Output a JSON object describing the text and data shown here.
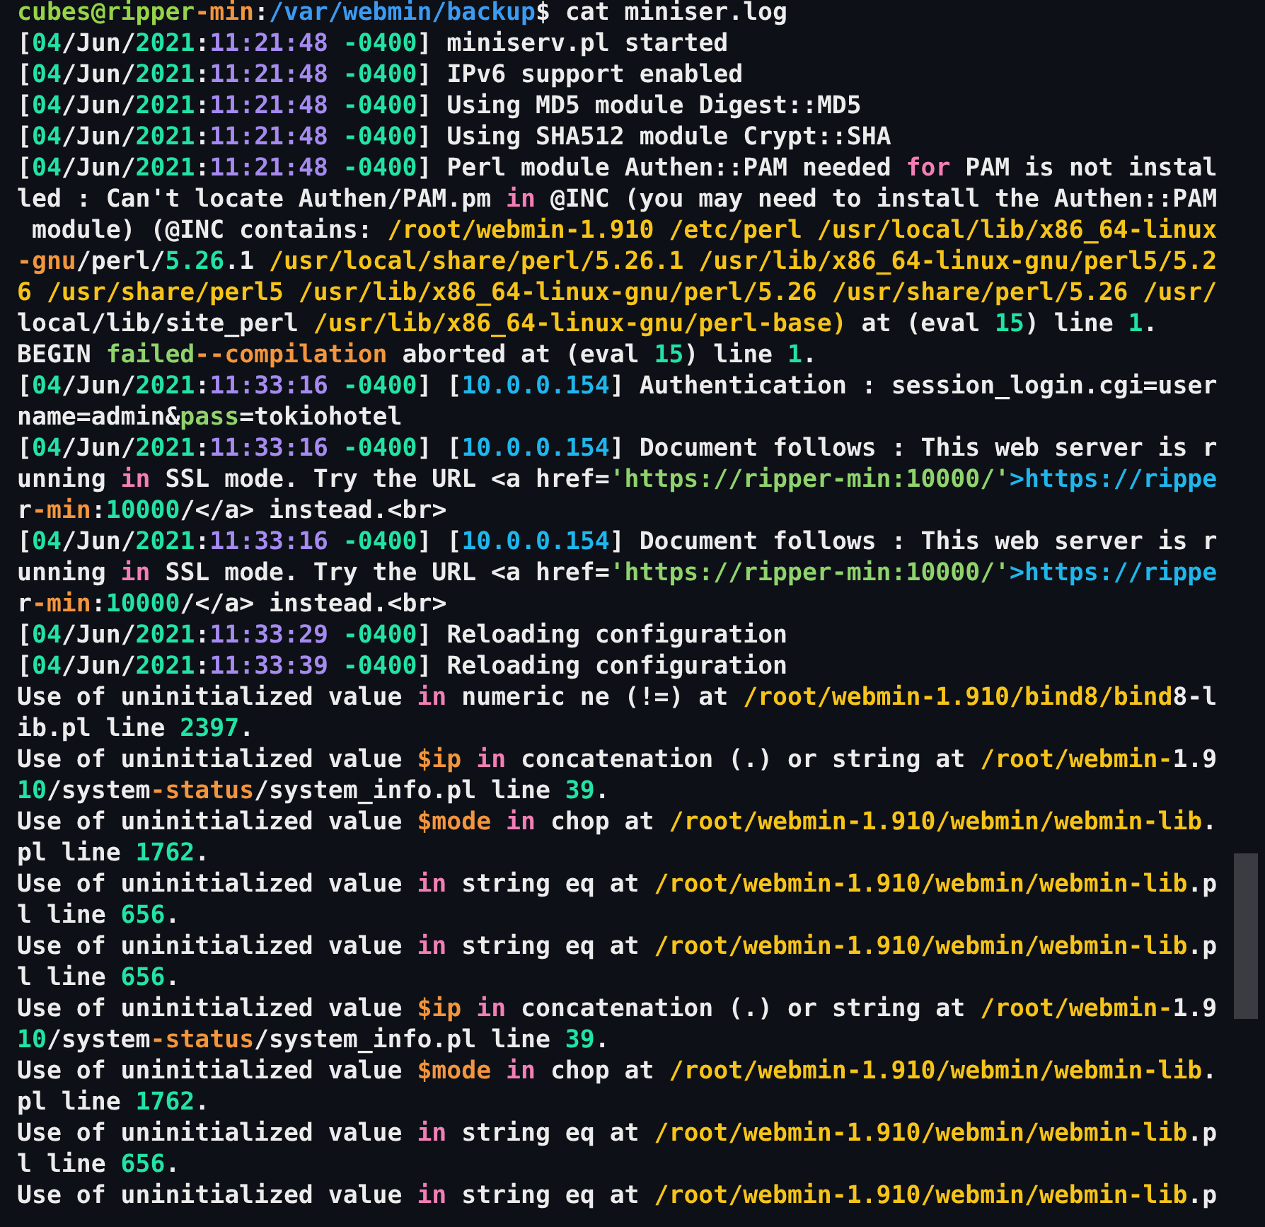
{
  "terminal": {
    "lines": [
      {
        "segments": [
          {
            "kind": "user",
            "text": "cubes@ripper"
          },
          {
            "kind": "var",
            "text": "-min"
          },
          {
            "kind": "plain",
            "text": ":"
          },
          {
            "kind": "dir",
            "text": "/var/webmin/backup"
          },
          {
            "kind": "plain",
            "text": "$ cat miniser.log"
          }
        ]
      },
      {
        "segments": [
          {
            "kind": "plain",
            "text": "["
          },
          {
            "kind": "num",
            "text": "04"
          },
          {
            "kind": "plain",
            "text": "/Jun/"
          },
          {
            "kind": "num",
            "text": "2021"
          },
          {
            "kind": "plain",
            "text": ":"
          },
          {
            "kind": "time",
            "text": "11:21:48"
          },
          {
            "kind": "num",
            "text": " -0400"
          },
          {
            "kind": "plain",
            "text": "] miniserv.pl started"
          }
        ]
      },
      {
        "segments": [
          {
            "kind": "plain",
            "text": "["
          },
          {
            "kind": "num",
            "text": "04"
          },
          {
            "kind": "plain",
            "text": "/Jun/"
          },
          {
            "kind": "num",
            "text": "2021"
          },
          {
            "kind": "plain",
            "text": ":"
          },
          {
            "kind": "time",
            "text": "11:21:48"
          },
          {
            "kind": "num",
            "text": " -0400"
          },
          {
            "kind": "plain",
            "text": "] IPv6 support enabled"
          }
        ]
      },
      {
        "segments": [
          {
            "kind": "plain",
            "text": "["
          },
          {
            "kind": "num",
            "text": "04"
          },
          {
            "kind": "plain",
            "text": "/Jun/"
          },
          {
            "kind": "num",
            "text": "2021"
          },
          {
            "kind": "plain",
            "text": ":"
          },
          {
            "kind": "time",
            "text": "11:21:48"
          },
          {
            "kind": "num",
            "text": " -0400"
          },
          {
            "kind": "plain",
            "text": "] Using MD5 module Digest::MD5"
          }
        ]
      },
      {
        "segments": [
          {
            "kind": "plain",
            "text": "["
          },
          {
            "kind": "num",
            "text": "04"
          },
          {
            "kind": "plain",
            "text": "/Jun/"
          },
          {
            "kind": "num",
            "text": "2021"
          },
          {
            "kind": "plain",
            "text": ":"
          },
          {
            "kind": "time",
            "text": "11:21:48"
          },
          {
            "kind": "num",
            "text": " -0400"
          },
          {
            "kind": "plain",
            "text": "] Using SHA512 module Crypt::SHA"
          }
        ]
      },
      {
        "segments": [
          {
            "kind": "plain",
            "text": "["
          },
          {
            "kind": "num",
            "text": "04"
          },
          {
            "kind": "plain",
            "text": "/Jun/"
          },
          {
            "kind": "num",
            "text": "2021"
          },
          {
            "kind": "plain",
            "text": ":"
          },
          {
            "kind": "time",
            "text": "11:21:48"
          },
          {
            "kind": "num",
            "text": " -0400"
          },
          {
            "kind": "plain",
            "text": "] Perl module Authen::PAM needed "
          },
          {
            "kind": "kw",
            "text": "for"
          },
          {
            "kind": "plain",
            "text": " PAM is not instal"
          }
        ]
      },
      {
        "segments": [
          {
            "kind": "plain",
            "text": "led : Can't locate Authen/PAM.pm "
          },
          {
            "kind": "kw",
            "text": "in"
          },
          {
            "kind": "plain",
            "text": " @INC (you may need to install the Authen::PAM"
          }
        ]
      },
      {
        "segments": [
          {
            "kind": "plain",
            "text": " module) (@INC contains: "
          },
          {
            "kind": "path",
            "text": "/root/webmin-1.910 /etc/perl /usr/local/lib/x86_64-linux"
          }
        ]
      },
      {
        "segments": [
          {
            "kind": "var",
            "text": "-gnu"
          },
          {
            "kind": "plain",
            "text": "/perl/"
          },
          {
            "kind": "num",
            "text": "5.26"
          },
          {
            "kind": "plain",
            "text": ".1 "
          },
          {
            "kind": "path",
            "text": "/usr/local/share/perl/5.26.1 /usr/lib/x86_64-linux-gnu/perl5/5.2"
          }
        ]
      },
      {
        "segments": [
          {
            "kind": "path",
            "text": "6 /usr/share/perl5 /usr/lib/x86_64-linux-gnu/perl/5.26 /usr/share/perl/5.26 /usr/"
          }
        ]
      },
      {
        "segments": [
          {
            "kind": "plain",
            "text": "local/lib/site_perl "
          },
          {
            "kind": "path",
            "text": "/usr/lib/x86_64-linux-gnu/perl-base)"
          },
          {
            "kind": "plain",
            "text": " at (eval "
          },
          {
            "kind": "num",
            "text": "15"
          },
          {
            "kind": "plain",
            "text": ") line "
          },
          {
            "kind": "num",
            "text": "1"
          },
          {
            "kind": "plain",
            "text": "."
          }
        ]
      },
      {
        "segments": [
          {
            "kind": "plain",
            "text": "BEGIN "
          },
          {
            "kind": "str",
            "text": "failed"
          },
          {
            "kind": "var",
            "text": "--compilation"
          },
          {
            "kind": "plain",
            "text": " aborted at (eval "
          },
          {
            "kind": "num",
            "text": "15"
          },
          {
            "kind": "plain",
            "text": ") line "
          },
          {
            "kind": "num",
            "text": "1"
          },
          {
            "kind": "plain",
            "text": "."
          }
        ]
      },
      {
        "segments": [
          {
            "kind": "plain",
            "text": "["
          },
          {
            "kind": "num",
            "text": "04"
          },
          {
            "kind": "plain",
            "text": "/Jun/"
          },
          {
            "kind": "num",
            "text": "2021"
          },
          {
            "kind": "plain",
            "text": ":"
          },
          {
            "kind": "time",
            "text": "11:33:16"
          },
          {
            "kind": "num",
            "text": " -0400"
          },
          {
            "kind": "plain",
            "text": "] ["
          },
          {
            "kind": "link",
            "text": "10.0.0.154"
          },
          {
            "kind": "plain",
            "text": "] Authentication : session_login.cgi=user"
          }
        ]
      },
      {
        "segments": [
          {
            "kind": "plain",
            "text": "name=admin&"
          },
          {
            "kind": "str",
            "text": "pass"
          },
          {
            "kind": "plain",
            "text": "=tokiohotel"
          }
        ]
      },
      {
        "segments": [
          {
            "kind": "plain",
            "text": "["
          },
          {
            "kind": "num",
            "text": "04"
          },
          {
            "kind": "plain",
            "text": "/Jun/"
          },
          {
            "kind": "num",
            "text": "2021"
          },
          {
            "kind": "plain",
            "text": ":"
          },
          {
            "kind": "time",
            "text": "11:33:16"
          },
          {
            "kind": "num",
            "text": " -0400"
          },
          {
            "kind": "plain",
            "text": "] ["
          },
          {
            "kind": "link",
            "text": "10.0.0.154"
          },
          {
            "kind": "plain",
            "text": "] Document follows : This web server is r"
          }
        ]
      },
      {
        "segments": [
          {
            "kind": "plain",
            "text": "unning "
          },
          {
            "kind": "kw",
            "text": "in"
          },
          {
            "kind": "plain",
            "text": " SSL mode. Try the URL <a href="
          },
          {
            "kind": "str",
            "text": "'https://ripper-min:10000/'"
          },
          {
            "kind": "link",
            "text": ">https://rippe"
          }
        ]
      },
      {
        "segments": [
          {
            "kind": "plain",
            "text": "r"
          },
          {
            "kind": "var",
            "text": "-min"
          },
          {
            "kind": "plain",
            "text": ":"
          },
          {
            "kind": "num",
            "text": "10000"
          },
          {
            "kind": "plain",
            "text": "/</a> instead.<br>"
          }
        ]
      },
      {
        "segments": [
          {
            "kind": "plain",
            "text": "["
          },
          {
            "kind": "num",
            "text": "04"
          },
          {
            "kind": "plain",
            "text": "/Jun/"
          },
          {
            "kind": "num",
            "text": "2021"
          },
          {
            "kind": "plain",
            "text": ":"
          },
          {
            "kind": "time",
            "text": "11:33:16"
          },
          {
            "kind": "num",
            "text": " -0400"
          },
          {
            "kind": "plain",
            "text": "] ["
          },
          {
            "kind": "link",
            "text": "10.0.0.154"
          },
          {
            "kind": "plain",
            "text": "] Document follows : This web server is r"
          }
        ]
      },
      {
        "segments": [
          {
            "kind": "plain",
            "text": "unning "
          },
          {
            "kind": "kw",
            "text": "in"
          },
          {
            "kind": "plain",
            "text": " SSL mode. Try the URL <a href="
          },
          {
            "kind": "str",
            "text": "'https://ripper-min:10000/'"
          },
          {
            "kind": "link",
            "text": ">https://rippe"
          }
        ]
      },
      {
        "segments": [
          {
            "kind": "plain",
            "text": "r"
          },
          {
            "kind": "var",
            "text": "-min"
          },
          {
            "kind": "plain",
            "text": ":"
          },
          {
            "kind": "num",
            "text": "10000"
          },
          {
            "kind": "plain",
            "text": "/</a> instead.<br>"
          }
        ]
      },
      {
        "segments": [
          {
            "kind": "plain",
            "text": "["
          },
          {
            "kind": "num",
            "text": "04"
          },
          {
            "kind": "plain",
            "text": "/Jun/"
          },
          {
            "kind": "num",
            "text": "2021"
          },
          {
            "kind": "plain",
            "text": ":"
          },
          {
            "kind": "time",
            "text": "11:33:29"
          },
          {
            "kind": "num",
            "text": " -0400"
          },
          {
            "kind": "plain",
            "text": "] Reloading configuration"
          }
        ]
      },
      {
        "segments": [
          {
            "kind": "plain",
            "text": "["
          },
          {
            "kind": "num",
            "text": "04"
          },
          {
            "kind": "plain",
            "text": "/Jun/"
          },
          {
            "kind": "num",
            "text": "2021"
          },
          {
            "kind": "plain",
            "text": ":"
          },
          {
            "kind": "time",
            "text": "11:33:39"
          },
          {
            "kind": "num",
            "text": " -0400"
          },
          {
            "kind": "plain",
            "text": "] Reloading configuration"
          }
        ]
      },
      {
        "segments": [
          {
            "kind": "plain",
            "text": "Use of uninitialized value "
          },
          {
            "kind": "kw",
            "text": "in"
          },
          {
            "kind": "plain",
            "text": " numeric ne (!=) at "
          },
          {
            "kind": "path",
            "text": "/root/webmin-1.910/bind8/bind"
          },
          {
            "kind": "plain",
            "text": "8-l"
          }
        ]
      },
      {
        "segments": [
          {
            "kind": "plain",
            "text": "ib.pl line "
          },
          {
            "kind": "num",
            "text": "2397"
          },
          {
            "kind": "plain",
            "text": "."
          }
        ]
      },
      {
        "segments": [
          {
            "kind": "plain",
            "text": "Use of uninitialized value "
          },
          {
            "kind": "var",
            "text": "$ip"
          },
          {
            "kind": "kw",
            "text": " in"
          },
          {
            "kind": "plain",
            "text": " concatenation (.) or string at "
          },
          {
            "kind": "path",
            "text": "/root/webmin-"
          },
          {
            "kind": "plain",
            "text": "1.9"
          }
        ]
      },
      {
        "segments": [
          {
            "kind": "num",
            "text": "10"
          },
          {
            "kind": "plain",
            "text": "/system"
          },
          {
            "kind": "var",
            "text": "-status"
          },
          {
            "kind": "plain",
            "text": "/system_info.pl line "
          },
          {
            "kind": "num",
            "text": "39"
          },
          {
            "kind": "plain",
            "text": "."
          }
        ]
      },
      {
        "segments": [
          {
            "kind": "plain",
            "text": "Use of uninitialized value "
          },
          {
            "kind": "var",
            "text": "$mode"
          },
          {
            "kind": "kw",
            "text": " in"
          },
          {
            "kind": "plain",
            "text": " chop at "
          },
          {
            "kind": "path",
            "text": "/root/webmin-1.910/webmin/webmin-lib"
          },
          {
            "kind": "plain",
            "text": "."
          }
        ]
      },
      {
        "segments": [
          {
            "kind": "plain",
            "text": "pl line "
          },
          {
            "kind": "num",
            "text": "1762"
          },
          {
            "kind": "plain",
            "text": "."
          }
        ]
      },
      {
        "segments": [
          {
            "kind": "plain",
            "text": "Use of uninitialized value "
          },
          {
            "kind": "kw",
            "text": "in"
          },
          {
            "kind": "plain",
            "text": " string eq at "
          },
          {
            "kind": "path",
            "text": "/root/webmin-1.910/webmin/webmin-lib"
          },
          {
            "kind": "plain",
            "text": ".p"
          }
        ]
      },
      {
        "segments": [
          {
            "kind": "plain",
            "text": "l line "
          },
          {
            "kind": "num",
            "text": "656"
          },
          {
            "kind": "plain",
            "text": "."
          }
        ]
      },
      {
        "segments": [
          {
            "kind": "plain",
            "text": "Use of uninitialized value "
          },
          {
            "kind": "kw",
            "text": "in"
          },
          {
            "kind": "plain",
            "text": " string eq at "
          },
          {
            "kind": "path",
            "text": "/root/webmin-1.910/webmin/webmin-lib"
          },
          {
            "kind": "plain",
            "text": ".p"
          }
        ]
      },
      {
        "segments": [
          {
            "kind": "plain",
            "text": "l line "
          },
          {
            "kind": "num",
            "text": "656"
          },
          {
            "kind": "plain",
            "text": "."
          }
        ]
      },
      {
        "segments": [
          {
            "kind": "plain",
            "text": "Use of uninitialized value "
          },
          {
            "kind": "var",
            "text": "$ip"
          },
          {
            "kind": "kw",
            "text": " in"
          },
          {
            "kind": "plain",
            "text": " concatenation (.) or string at "
          },
          {
            "kind": "path",
            "text": "/root/webmin-"
          },
          {
            "kind": "plain",
            "text": "1.9"
          }
        ]
      },
      {
        "segments": [
          {
            "kind": "num",
            "text": "10"
          },
          {
            "kind": "plain",
            "text": "/system"
          },
          {
            "kind": "var",
            "text": "-status"
          },
          {
            "kind": "plain",
            "text": "/system_info.pl line "
          },
          {
            "kind": "num",
            "text": "39"
          },
          {
            "kind": "plain",
            "text": "."
          }
        ]
      },
      {
        "segments": [
          {
            "kind": "plain",
            "text": "Use of uninitialized value "
          },
          {
            "kind": "var",
            "text": "$mode"
          },
          {
            "kind": "kw",
            "text": " in"
          },
          {
            "kind": "plain",
            "text": " chop at "
          },
          {
            "kind": "path",
            "text": "/root/webmin-1.910/webmin/webmin-lib"
          },
          {
            "kind": "plain",
            "text": "."
          }
        ]
      },
      {
        "segments": [
          {
            "kind": "plain",
            "text": "pl line "
          },
          {
            "kind": "num",
            "text": "1762"
          },
          {
            "kind": "plain",
            "text": "."
          }
        ]
      },
      {
        "segments": [
          {
            "kind": "plain",
            "text": "Use of uninitialized value "
          },
          {
            "kind": "kw",
            "text": "in"
          },
          {
            "kind": "plain",
            "text": " string eq at "
          },
          {
            "kind": "path",
            "text": "/root/webmin-1.910/webmin/webmin-lib"
          },
          {
            "kind": "plain",
            "text": ".p"
          }
        ]
      },
      {
        "segments": [
          {
            "kind": "plain",
            "text": "l line "
          },
          {
            "kind": "num",
            "text": "656"
          },
          {
            "kind": "plain",
            "text": "."
          }
        ]
      },
      {
        "segments": [
          {
            "kind": "plain",
            "text": "Use of uninitialized value "
          },
          {
            "kind": "kw",
            "text": "in"
          },
          {
            "kind": "plain",
            "text": " string eq at "
          },
          {
            "kind": "path",
            "text": "/root/webmin-1.910/webmin/webmin-lib"
          },
          {
            "kind": "plain",
            "text": ".p"
          }
        ]
      }
    ]
  }
}
